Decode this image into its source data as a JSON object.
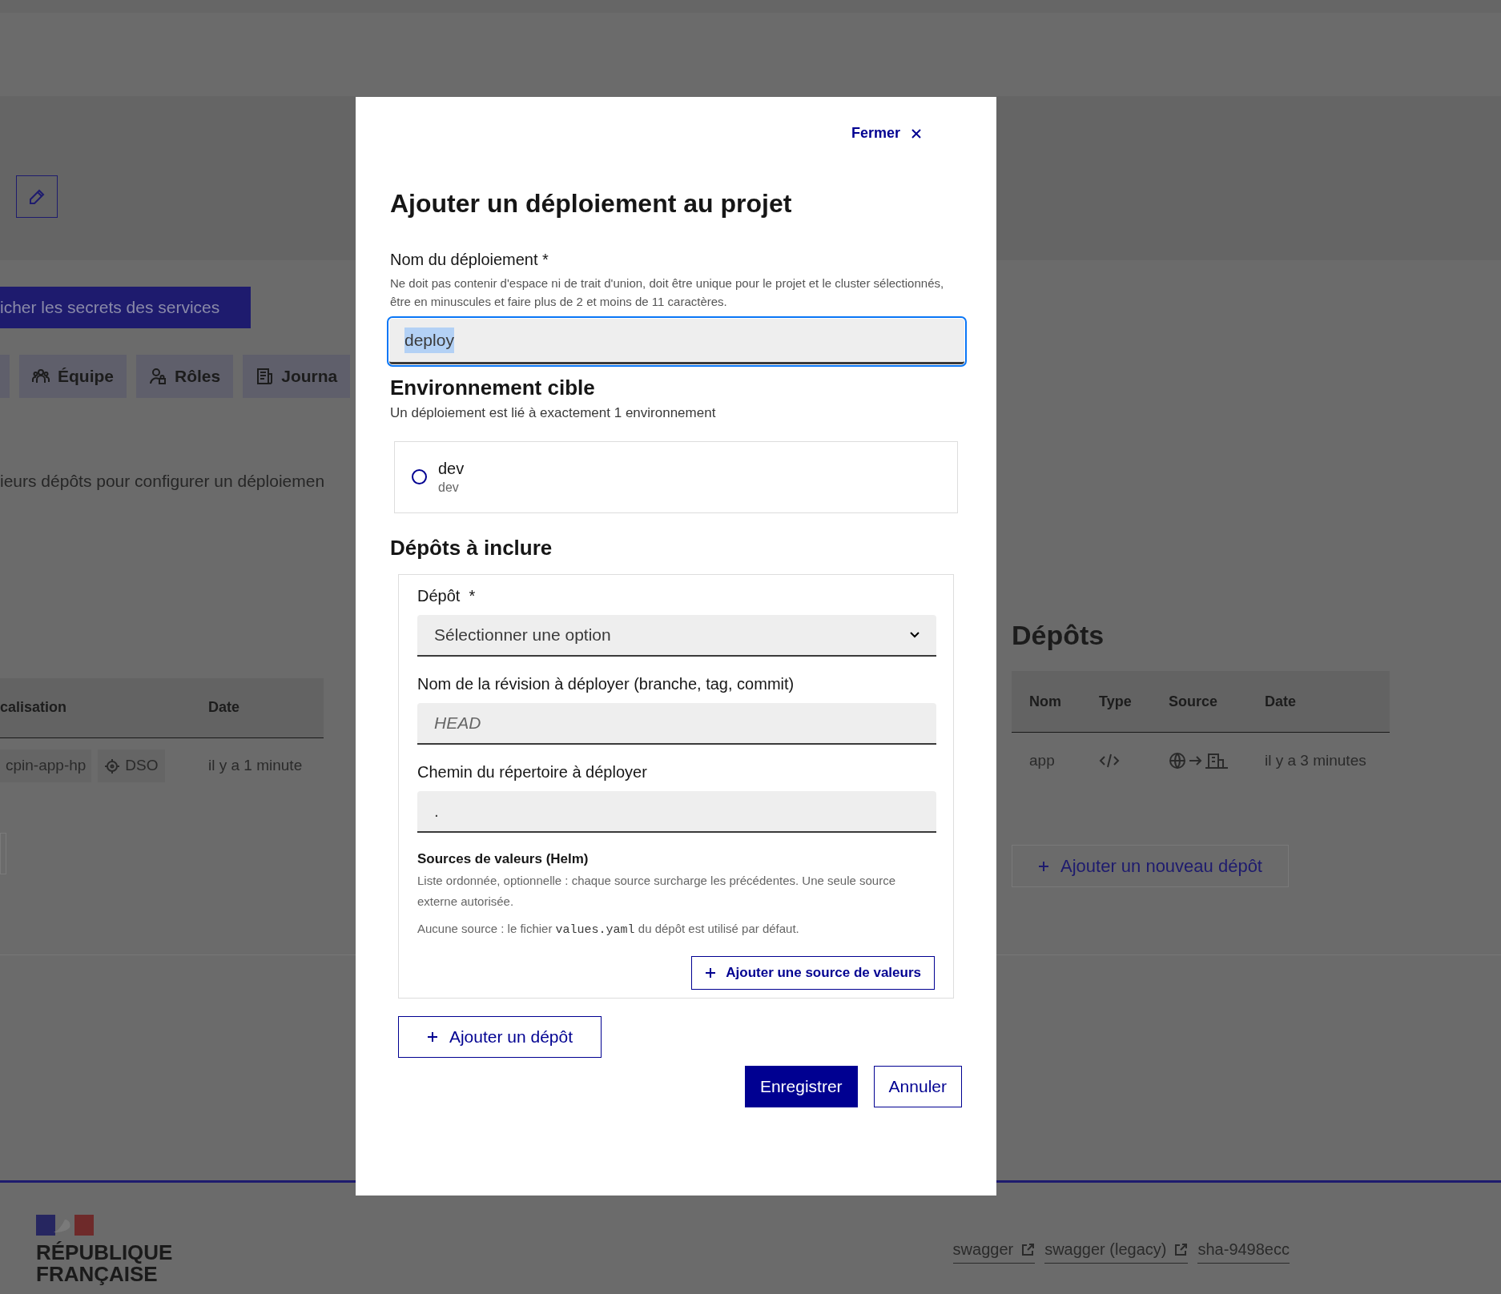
{
  "background_page": {
    "secrets_button": "icher les secrets des services",
    "tabs": [
      {
        "label": "Équipe",
        "selected": false
      },
      {
        "label": "Rôles",
        "selected": false
      },
      {
        "label": "Journa",
        "selected": false
      }
    ],
    "intro_text": "ieurs dépôts pour configurer un déploiemen",
    "deployments_table": {
      "columns": [
        "calisation",
        "Date"
      ],
      "rows": [
        {
          "location": "cpin-app-hp",
          "zone": "DSO",
          "date": "il y a 1 minute"
        }
      ]
    },
    "repositories": {
      "title": "Dépôts",
      "columns": [
        "Nom",
        "Type",
        "Source",
        "Date"
      ],
      "rows": [
        {
          "name": "app",
          "date": "il y a 3 minutes"
        }
      ],
      "add_button": "Ajouter un nouveau dépôt"
    },
    "footer": {
      "brand": [
        "RÉPUBLIQUE",
        "FRANÇAISE"
      ],
      "links": [
        {
          "label": "swagger",
          "external": true
        },
        {
          "label": "swagger (legacy)",
          "external": true
        },
        {
          "label": "sha-9498ecc",
          "external": false
        }
      ]
    }
  },
  "modal": {
    "close": "Fermer",
    "title": "Ajouter un déploiement au projet",
    "name_field": {
      "label": "Nom du déploiement *",
      "hint": "Ne doit pas contenir d'espace ni de trait d'union, doit être unique pour le projet et le cluster sélectionnés, être en minuscules et faire plus de 2 et moins de 11 caractères.",
      "value": "deploy",
      "value_selected": true,
      "focused": true
    },
    "environment": {
      "title": "Environnement cible",
      "subtitle": "Un déploiement est lié à exactement 1 environnement",
      "options": [
        {
          "label": "dev",
          "detail": "dev",
          "selected": false
        }
      ]
    },
    "repositories": {
      "title": "Dépôts à inclure",
      "items": [
        {
          "repo_label": "Dépôt  *",
          "repo_placeholder": "Sélectionner une option",
          "revision_label": "Nom de la révision à déployer (branche, tag, commit)",
          "revision_placeholder": "HEAD",
          "path_label": "Chemin du répertoire à déployer",
          "path_value": ".",
          "sources_title": "Sources de valeurs (Helm)",
          "sources_description": "Liste ordonnée, optionnelle : chaque source surcharge les précédentes. Une seule source externe autorisée.",
          "sources_default": [
            "Aucune source : le fichier ",
            "values.yaml",
            " du dépôt est utilisé par défaut."
          ],
          "add_source_button": "Ajouter une source de valeurs"
        }
      ],
      "add_button": "Ajouter un dépôt"
    },
    "buttons": [
      {
        "label": "Enregistrer",
        "kind": "primary"
      },
      {
        "label": "Annuler",
        "kind": "secondary"
      }
    ]
  }
}
